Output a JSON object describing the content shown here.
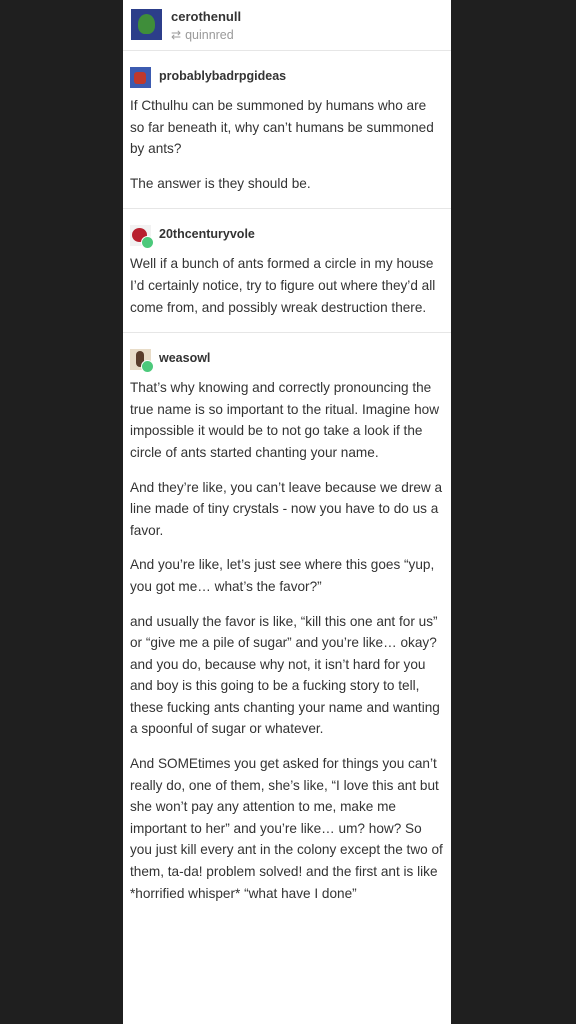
{
  "post": {
    "author": "cerothenull",
    "reblogged_from": "quinnred",
    "reblog_icon": "reblog-icon"
  },
  "entries": [
    {
      "username": "probablybadrpgideas",
      "paragraphs": [
        "If Cthulhu can be summoned by humans who are so far beneath it, why can’t humans be summoned by ants?",
        "The answer is they should be."
      ]
    },
    {
      "username": "20thcenturyvole",
      "paragraphs": [
        "Well if a bunch of ants formed a circle in my house I’d certainly notice, try to figure out where they’d all come from, and possibly wreak destruction there."
      ]
    },
    {
      "username": "weasowl",
      "paragraphs": [
        "That’s why knowing and correctly pronouncing the true name is so important to the ritual. Imagine how impossible it would be to not go take a look if the circle of ants started chanting your name.",
        "And they’re like, you can’t leave because we drew a line made of tiny crystals - now you have to do us a favor.",
        "And you’re like, let’s just see where this goes “yup, you got me… what’s the favor?”",
        "and usually the favor is like, “kill this one ant for us” or “give me a pile of sugar” and you’re like… okay? and you do, because why not, it isn’t hard for you and boy is this going to be a fucking story to tell, these fucking ants chanting your name and wanting a spoonful of sugar or whatever.",
        "And SOMEtimes you get asked for things you can’t really do, one of them, she’s like, “I love this ant but she won’t pay any attention to me, make me important to her” and you’re like… um? how? So you just kill every ant in the colony except the two of them, ta-da! problem solved! and the first ant is like *horrified whisper* “what have I done”"
      ]
    }
  ],
  "colors": {
    "background": "#1f1f1f",
    "card": "#ffffff",
    "text": "#333333",
    "muted": "#9a9a9a",
    "follow_badge": "#4cc97b"
  }
}
